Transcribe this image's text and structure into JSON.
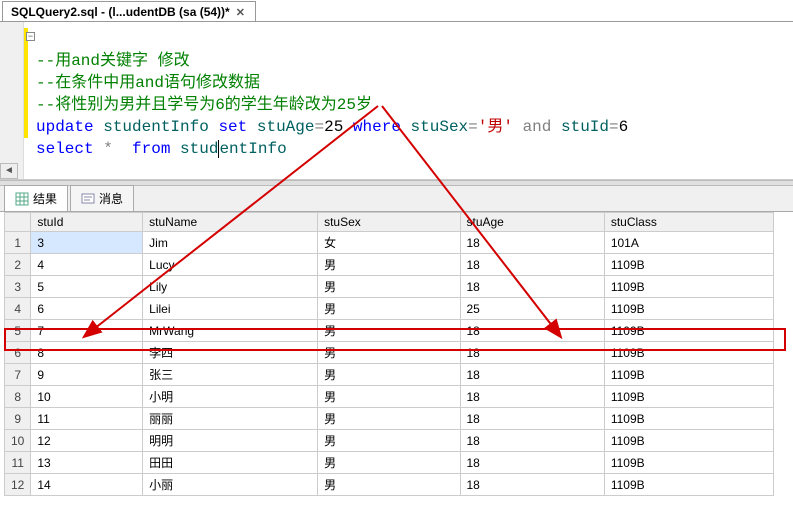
{
  "tab": {
    "title": "SQLQuery2.sql - (l...udentDB (sa (54))*"
  },
  "code": {
    "c1": "--用and关键字 修改",
    "c2": "--在条件中用and语句修改数据",
    "c3": "--将性别为男并且学号为6的学生年龄改为25岁",
    "l4": {
      "k_update": "update",
      "ident1": "studentInfo",
      "k_set": "set",
      "ident2": "stuAge",
      "eq": "=",
      "v25": "25",
      "k_where": "where",
      "ident3": "stuSex",
      "eq2": "=",
      "str_m": "'男'",
      "k_and": "and",
      "ident4": "stuId",
      "eq3": "=",
      "v6": "6"
    },
    "l5": {
      "k_select": "select",
      "star": "*",
      "k_from": "from",
      "ident1_a": "stud",
      "ident1_b": "entInfo"
    }
  },
  "result_tabs": {
    "results": "结果",
    "messages": "消息"
  },
  "columns": [
    "stuId",
    "stuName",
    "stuSex",
    "stuAge",
    "stuClass"
  ],
  "rows": [
    {
      "n": "1",
      "stuId": "3",
      "stuName": "Jim",
      "stuSex": "女",
      "stuAge": "18",
      "stuClass": "101A"
    },
    {
      "n": "2",
      "stuId": "4",
      "stuName": "Lucy",
      "stuSex": "男",
      "stuAge": "18",
      "stuClass": "1109B"
    },
    {
      "n": "3",
      "stuId": "5",
      "stuName": "Lily",
      "stuSex": "男",
      "stuAge": "18",
      "stuClass": "1109B"
    },
    {
      "n": "4",
      "stuId": "6",
      "stuName": "Lilei",
      "stuSex": "男",
      "stuAge": "25",
      "stuClass": "1109B"
    },
    {
      "n": "5",
      "stuId": "7",
      "stuName": "MrWang",
      "stuSex": "男",
      "stuAge": "18",
      "stuClass": "1109B"
    },
    {
      "n": "6",
      "stuId": "8",
      "stuName": "李四",
      "stuSex": "男",
      "stuAge": "18",
      "stuClass": "1109B"
    },
    {
      "n": "7",
      "stuId": "9",
      "stuName": "张三",
      "stuSex": "男",
      "stuAge": "18",
      "stuClass": "1109B"
    },
    {
      "n": "8",
      "stuId": "10",
      "stuName": "小明",
      "stuSex": "男",
      "stuAge": "18",
      "stuClass": "1109B"
    },
    {
      "n": "9",
      "stuId": "11",
      "stuName": "丽丽",
      "stuSex": "男",
      "stuAge": "18",
      "stuClass": "1109B"
    },
    {
      "n": "10",
      "stuId": "12",
      "stuName": "明明",
      "stuSex": "男",
      "stuAge": "18",
      "stuClass": "1109B"
    },
    {
      "n": "11",
      "stuId": "13",
      "stuName": "田田",
      "stuSex": "男",
      "stuAge": "18",
      "stuClass": "1109B"
    },
    {
      "n": "12",
      "stuId": "14",
      "stuName": "小丽",
      "stuSex": "男",
      "stuAge": "18",
      "stuClass": "1109B"
    }
  ]
}
